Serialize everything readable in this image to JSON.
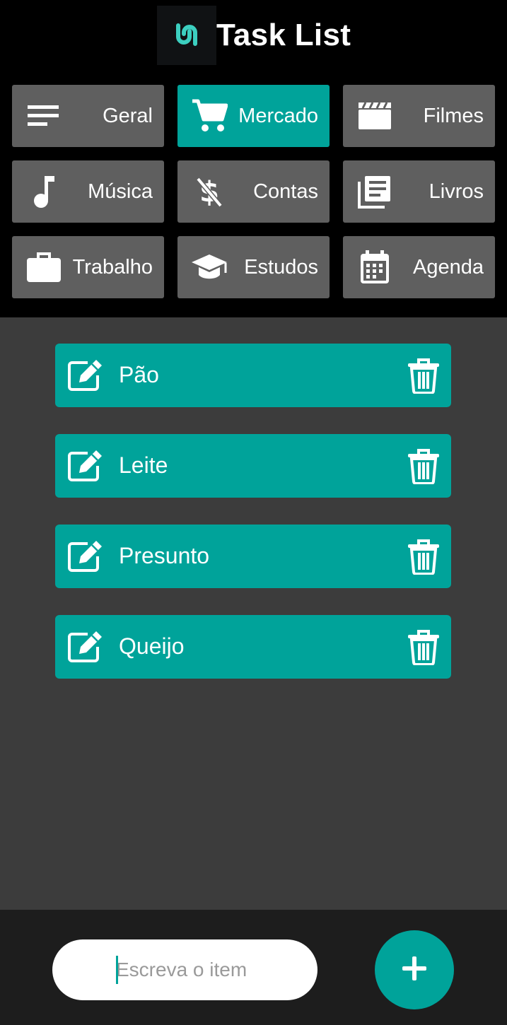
{
  "app": {
    "title": "Task List",
    "logo_icon": "app-logo-icon"
  },
  "categories": [
    {
      "label": "Geral",
      "icon": "menu-lines-icon",
      "active": false
    },
    {
      "label": "Mercado",
      "icon": "shopping-cart-icon",
      "active": true
    },
    {
      "label": "Filmes",
      "icon": "clapperboard-icon",
      "active": false
    },
    {
      "label": "Música",
      "icon": "music-note-icon",
      "active": false
    },
    {
      "label": "Contas",
      "icon": "money-off-icon",
      "active": false
    },
    {
      "label": "Livros",
      "icon": "library-books-icon",
      "active": false
    },
    {
      "label": "Trabalho",
      "icon": "briefcase-icon",
      "active": false
    },
    {
      "label": "Estudos",
      "icon": "graduation-cap-icon",
      "active": false
    },
    {
      "label": "Agenda",
      "icon": "calendar-icon",
      "active": false
    }
  ],
  "items": [
    {
      "text": "Pão"
    },
    {
      "text": "Leite"
    },
    {
      "text": "Presunto"
    },
    {
      "text": "Queijo"
    }
  ],
  "footer": {
    "input_placeholder": "Escreva o item",
    "add_icon": "plus-icon"
  },
  "colors": {
    "accent": "#00a39a",
    "tile": "#5f5f5f",
    "background": "#3c3c3c",
    "header": "#000000",
    "footer": "#1d1d1d"
  }
}
